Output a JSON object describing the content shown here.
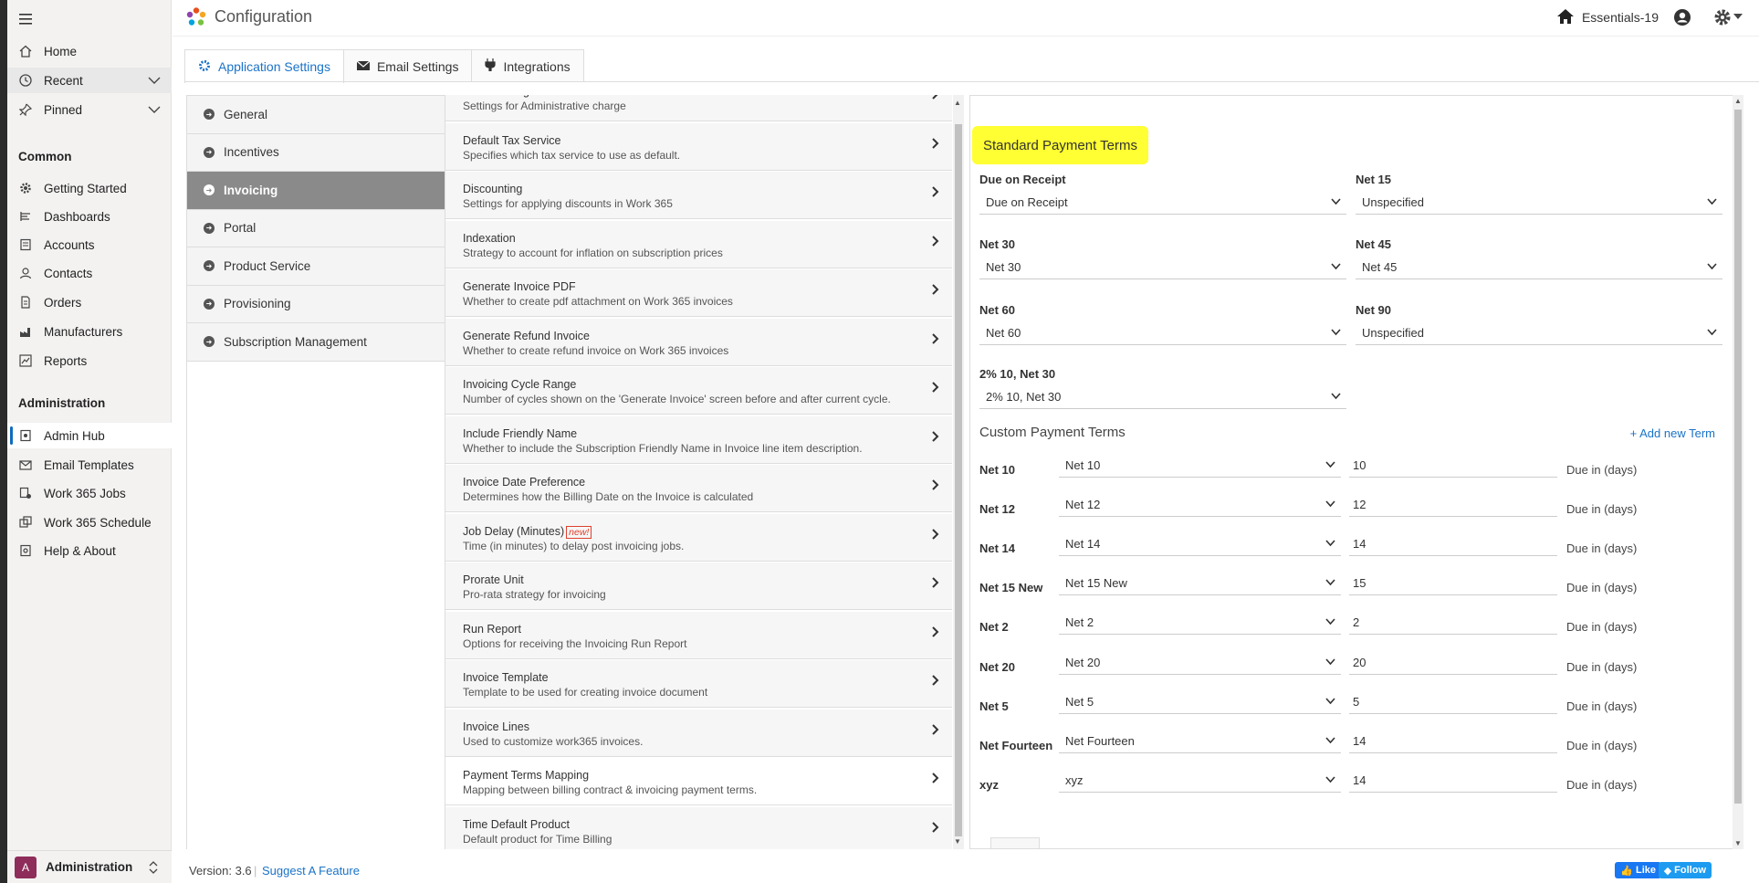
{
  "app": {
    "title": "Configuration",
    "environment": "Essentials-19"
  },
  "sidebar": {
    "top": [
      {
        "label": "Home",
        "icon": "home-icon"
      },
      {
        "label": "Recent",
        "icon": "clock-icon"
      },
      {
        "label": "Pinned",
        "icon": "pin-icon"
      }
    ],
    "common_header": "Common",
    "common": [
      {
        "label": "Getting Started",
        "icon": "gear-icon"
      },
      {
        "label": "Dashboards",
        "icon": "dashboard-icon"
      },
      {
        "label": "Accounts",
        "icon": "account-icon"
      },
      {
        "label": "Contacts",
        "icon": "contact-icon"
      },
      {
        "label": "Orders",
        "icon": "document-icon"
      },
      {
        "label": "Manufacturers",
        "icon": "factory-icon"
      },
      {
        "label": "Reports",
        "icon": "chart-icon"
      }
    ],
    "admin_header": "Administration",
    "admin": [
      {
        "label": "Admin Hub",
        "icon": "hub-icon"
      },
      {
        "label": "Email Templates",
        "icon": "email-template-icon"
      },
      {
        "label": "Work 365 Jobs",
        "icon": "jobs-icon"
      },
      {
        "label": "Work 365 Schedule",
        "icon": "schedule-icon"
      },
      {
        "label": "Help & About",
        "icon": "help-icon"
      }
    ],
    "area": {
      "initial": "A",
      "label": "Administration"
    }
  },
  "tabs": [
    {
      "label": "Application Settings",
      "icon": "gear-icon",
      "active": true
    },
    {
      "label": "Email Settings",
      "icon": "envelope-icon",
      "active": false
    },
    {
      "label": "Integrations",
      "icon": "plug-icon",
      "active": false
    }
  ],
  "categories": [
    {
      "label": "General",
      "active": false
    },
    {
      "label": "Incentives",
      "active": false
    },
    {
      "label": "Invoicing",
      "active": true
    },
    {
      "label": "Portal",
      "active": false
    },
    {
      "label": "Product Service",
      "active": false
    },
    {
      "label": "Provisioning",
      "active": false
    },
    {
      "label": "Subscription Management",
      "active": false
    }
  ],
  "settings": [
    {
      "title": "Admin Charge",
      "desc": "Settings for Administrative charge"
    },
    {
      "title": "Default Tax Service",
      "desc": "Specifies which tax service to use as default."
    },
    {
      "title": "Discounting",
      "desc": "Settings for applying discounts in Work 365"
    },
    {
      "title": "Indexation",
      "desc": "Strategy to account for inflation on subscription prices"
    },
    {
      "title": "Generate Invoice PDF",
      "desc": "Whether to create pdf attachment on Work 365 invoices"
    },
    {
      "title": "Generate Refund Invoice",
      "desc": "Whether to create refund invoice on Work 365 invoices"
    },
    {
      "title": "Invoicing Cycle Range",
      "desc": "Number of cycles shown on the 'Generate Invoice' screen before and after current cycle."
    },
    {
      "title": "Include Friendly Name",
      "desc": "Whether to include the Subscription Friendly Name in Invoice line item description."
    },
    {
      "title": "Invoice Date Preference",
      "desc": "Determines how the Billing Date on the Invoice is calculated"
    },
    {
      "title": "Job Delay (Minutes)",
      "desc": "Time (in minutes) to delay post invoicing jobs.",
      "badge": "new!"
    },
    {
      "title": "Prorate Unit",
      "desc": "Pro-rata strategy for invoicing"
    },
    {
      "title": "Run Report",
      "desc": "Options for receiving the Invoicing Run Report"
    },
    {
      "title": "Invoice Template",
      "desc": "Template to be used for creating invoice document"
    },
    {
      "title": "Invoice Lines",
      "desc": "Used to customize work365 invoices."
    },
    {
      "title": "Payment Terms Mapping",
      "desc": "Mapping between billing contract & invoicing payment terms."
    },
    {
      "title": "Time Default Product",
      "desc": "Default product for Time Billing"
    }
  ],
  "standard_terms": {
    "title": "Standard Payment Terms",
    "fields": [
      {
        "label": "Due on Receipt",
        "value": "Due on Receipt"
      },
      {
        "label": "Net 15",
        "value": "Unspecified"
      },
      {
        "label": "Net 30",
        "value": "Net 30"
      },
      {
        "label": "Net 45",
        "value": "Net 45"
      },
      {
        "label": "Net 60",
        "value": "Net 60"
      },
      {
        "label": "Net 90",
        "value": "Unspecified"
      },
      {
        "label": "2% 10, Net 30",
        "value": "2% 10, Net 30"
      }
    ]
  },
  "custom_terms": {
    "title": "Custom Payment Terms",
    "add_label": "Add new Term",
    "due_label": "Due in (days)",
    "rows": [
      {
        "label": "Net 10",
        "value": "Net 10",
        "days": "10"
      },
      {
        "label": "Net 12",
        "value": "Net 12",
        "days": "12"
      },
      {
        "label": "Net 14",
        "value": "Net 14",
        "days": "14"
      },
      {
        "label": "Net 15 New",
        "value": "Net 15 New",
        "days": "15"
      },
      {
        "label": "Net 2",
        "value": "Net 2",
        "days": "2"
      },
      {
        "label": "Net 20",
        "value": "Net 20",
        "days": "20"
      },
      {
        "label": "Net 5",
        "value": "Net 5",
        "days": "5"
      },
      {
        "label": "Net Fourteen",
        "value": "Net Fourteen",
        "days": "14"
      },
      {
        "label": "xyz",
        "value": "xyz",
        "days": "14"
      }
    ]
  },
  "footer": {
    "version": "Version: 3.6",
    "suggest": "Suggest A Feature",
    "like": "Like",
    "follow": "Follow"
  }
}
